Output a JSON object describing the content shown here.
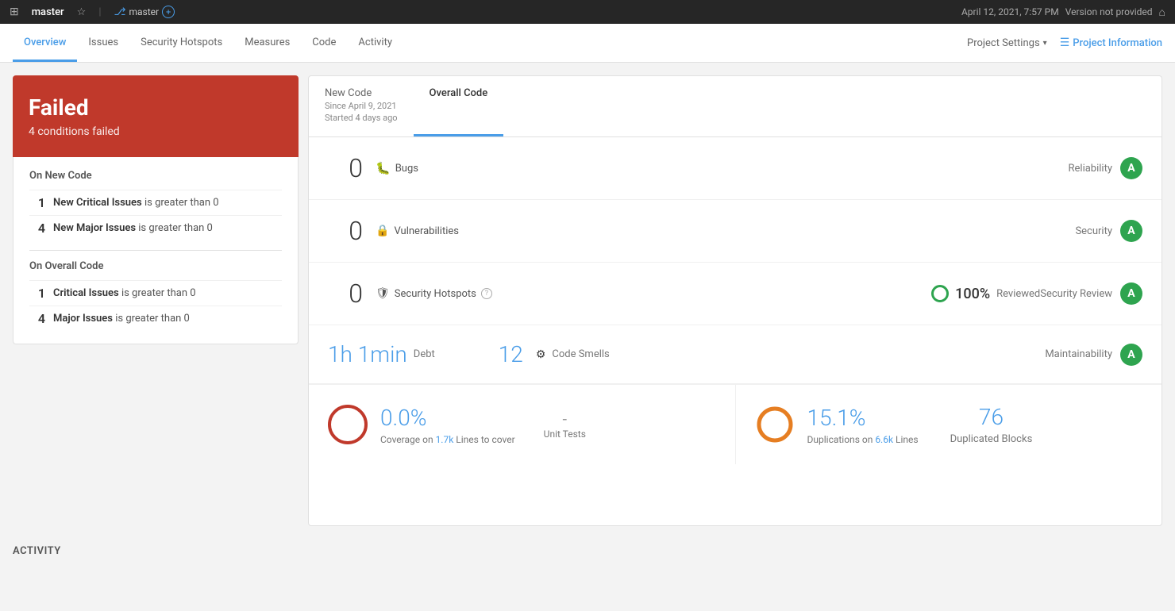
{
  "topbar": {
    "project_name": "master",
    "branch_name": "master",
    "timestamp": "April 12, 2021, 7:57 PM",
    "version": "Version not provided"
  },
  "navbar": {
    "tabs": [
      {
        "label": "Overview",
        "active": true
      },
      {
        "label": "Issues",
        "active": false
      },
      {
        "label": "Security Hotspots",
        "active": false
      },
      {
        "label": "Measures",
        "active": false
      },
      {
        "label": "Code",
        "active": false
      },
      {
        "label": "Activity",
        "active": false
      }
    ],
    "project_settings": "Project Settings",
    "project_information": "Project Information"
  },
  "failed": {
    "title": "Failed",
    "subtitle": "4 conditions failed"
  },
  "conditions": {
    "new_code_title": "On New Code",
    "new_code_items": [
      {
        "num": "1",
        "label": "New Critical Issues",
        "suffix": "is greater than 0"
      },
      {
        "num": "4",
        "label": "New Major Issues",
        "suffix": "is greater than 0"
      }
    ],
    "overall_code_title": "On Overall Code",
    "overall_code_items": [
      {
        "num": "1",
        "label": "Critical Issues",
        "suffix": "is greater than 0"
      },
      {
        "num": "4",
        "label": "Major Issues",
        "suffix": "is greater than 0"
      }
    ]
  },
  "code_tabs": {
    "new_code": {
      "label": "New Code",
      "subtitle1": "Since April 9, 2021",
      "subtitle2": "Started 4 days ago"
    },
    "overall_code": {
      "label": "Overall Code"
    }
  },
  "metrics": {
    "bugs": {
      "value": "0",
      "label": "Bugs",
      "category": "Reliability",
      "grade": "A"
    },
    "vulnerabilities": {
      "value": "0",
      "label": "Vulnerabilities",
      "category": "Security",
      "grade": "A"
    },
    "security_hotspots": {
      "value": "0",
      "label": "Security Hotspots",
      "review_pct": "100%",
      "review_label": "Reviewed",
      "category": "Security Review",
      "grade": "A"
    },
    "debt": {
      "value": "1h 1min",
      "label": "Debt",
      "smells_value": "12",
      "smells_label": "Code Smells",
      "category": "Maintainability",
      "grade": "A"
    }
  },
  "coverage": {
    "pct": "0.0%",
    "lines_label": "Coverage on",
    "lines_value": "1.7k",
    "lines_suffix": "Lines to cover",
    "unit_tests_dash": "-",
    "unit_tests_label": "Unit Tests"
  },
  "duplication": {
    "pct": "15.1%",
    "lines_label": "Duplications on",
    "lines_value": "6.6k",
    "lines_suffix": "Lines",
    "blocks_value": "76",
    "blocks_label": "Duplicated Blocks"
  },
  "activity": {
    "title": "ACTIVITY"
  }
}
